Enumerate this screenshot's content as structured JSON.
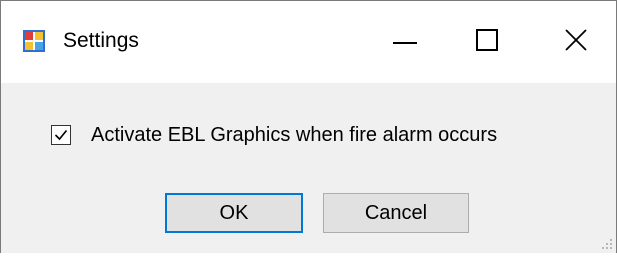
{
  "window": {
    "title": "Settings",
    "icon": "settings-app-icon",
    "controls": {
      "minimize_icon": "minimize-icon",
      "maximize_icon": "maximize-icon",
      "close_icon": "close-icon"
    }
  },
  "settings": {
    "activate_ebl": {
      "label": "Activate EBL Graphics when fire alarm occurs",
      "checked": true
    }
  },
  "buttons": {
    "ok_label": "OK",
    "cancel_label": "Cancel"
  },
  "colors": {
    "focus_border": "#0078d7",
    "client_background": "#f0f0f0",
    "titlebar_background": "#ffffff"
  }
}
